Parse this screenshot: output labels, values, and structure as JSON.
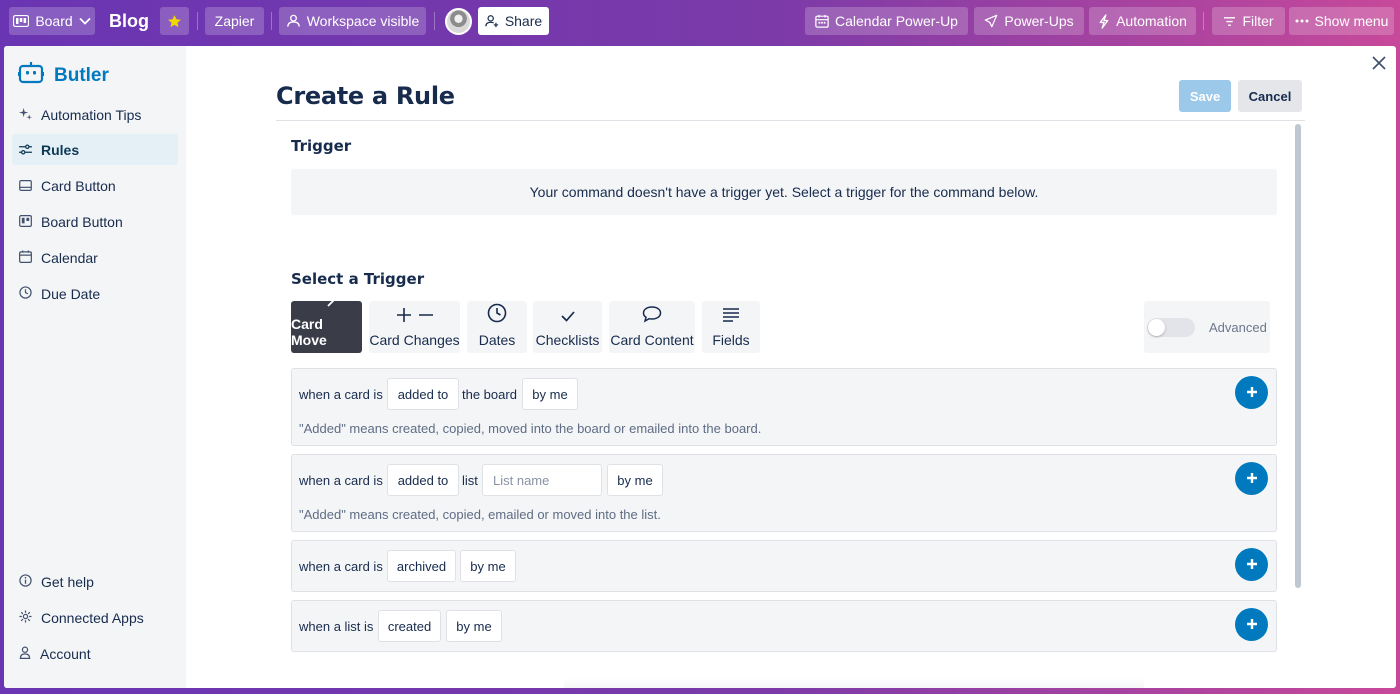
{
  "topbar": {
    "board_label": "Board",
    "title": "Blog",
    "zapier_label": "Zapier",
    "visibility_label": "Workspace visible",
    "share_label": "Share",
    "calendar_powerup_label": "Calendar Power-Up",
    "powerups_label": "Power-Ups",
    "automation_label": "Automation",
    "filter_label": "Filter",
    "show_menu_label": "Show menu",
    "star_color": "#f2d600"
  },
  "sidebar": {
    "brand": "Butler",
    "items": [
      {
        "label": "Automation Tips",
        "icon": "sparkle-icon"
      },
      {
        "label": "Rules",
        "icon": "sliders-icon",
        "active": true
      },
      {
        "label": "Card Button",
        "icon": "card-icon"
      },
      {
        "label": "Board Button",
        "icon": "board-icon"
      },
      {
        "label": "Calendar",
        "icon": "calendar-icon"
      },
      {
        "label": "Due Date",
        "icon": "clock-icon"
      }
    ],
    "bottom_items": [
      {
        "label": "Get help",
        "icon": "info-icon"
      },
      {
        "label": "Connected Apps",
        "icon": "gear-icon"
      },
      {
        "label": "Account",
        "icon": "person-icon"
      }
    ]
  },
  "main": {
    "heading": "Create a Rule",
    "save_label": "Save",
    "cancel_label": "Cancel",
    "trigger_title": "Trigger",
    "trigger_notice": "Your command doesn't have a trigger yet. Select a trigger for the command below.",
    "select_trigger_title": "Select a Trigger",
    "tabs": [
      {
        "label": "Card Move",
        "icon": "arrow-right-icon",
        "active": true
      },
      {
        "label": "Card Changes",
        "icon": "plus-minus-icon"
      },
      {
        "label": "Dates",
        "icon": "clock-icon"
      },
      {
        "label": "Checklists",
        "icon": "checkmark-icon"
      },
      {
        "label": "Card Content",
        "icon": "comment-icon"
      },
      {
        "label": "Fields",
        "icon": "lines-icon"
      }
    ],
    "advanced_label": "Advanced",
    "advanced_on": false,
    "rules": [
      {
        "prefix": "when a card is",
        "action": "added to",
        "middle": "the board",
        "actor": "by me",
        "note": "\"Added\" means created, copied, moved into the board or emailed into the board."
      },
      {
        "prefix": "when a card is",
        "action": "added to",
        "middle": "list",
        "list_placeholder": "List name",
        "actor": "by me",
        "note": "\"Added\" means created, copied, emailed or moved into the list."
      },
      {
        "prefix": "when a card is",
        "action": "archived",
        "actor": "by me"
      },
      {
        "prefix": "when a list is",
        "action": "created",
        "actor": "by me"
      }
    ],
    "accent_color": "#0079bf"
  }
}
